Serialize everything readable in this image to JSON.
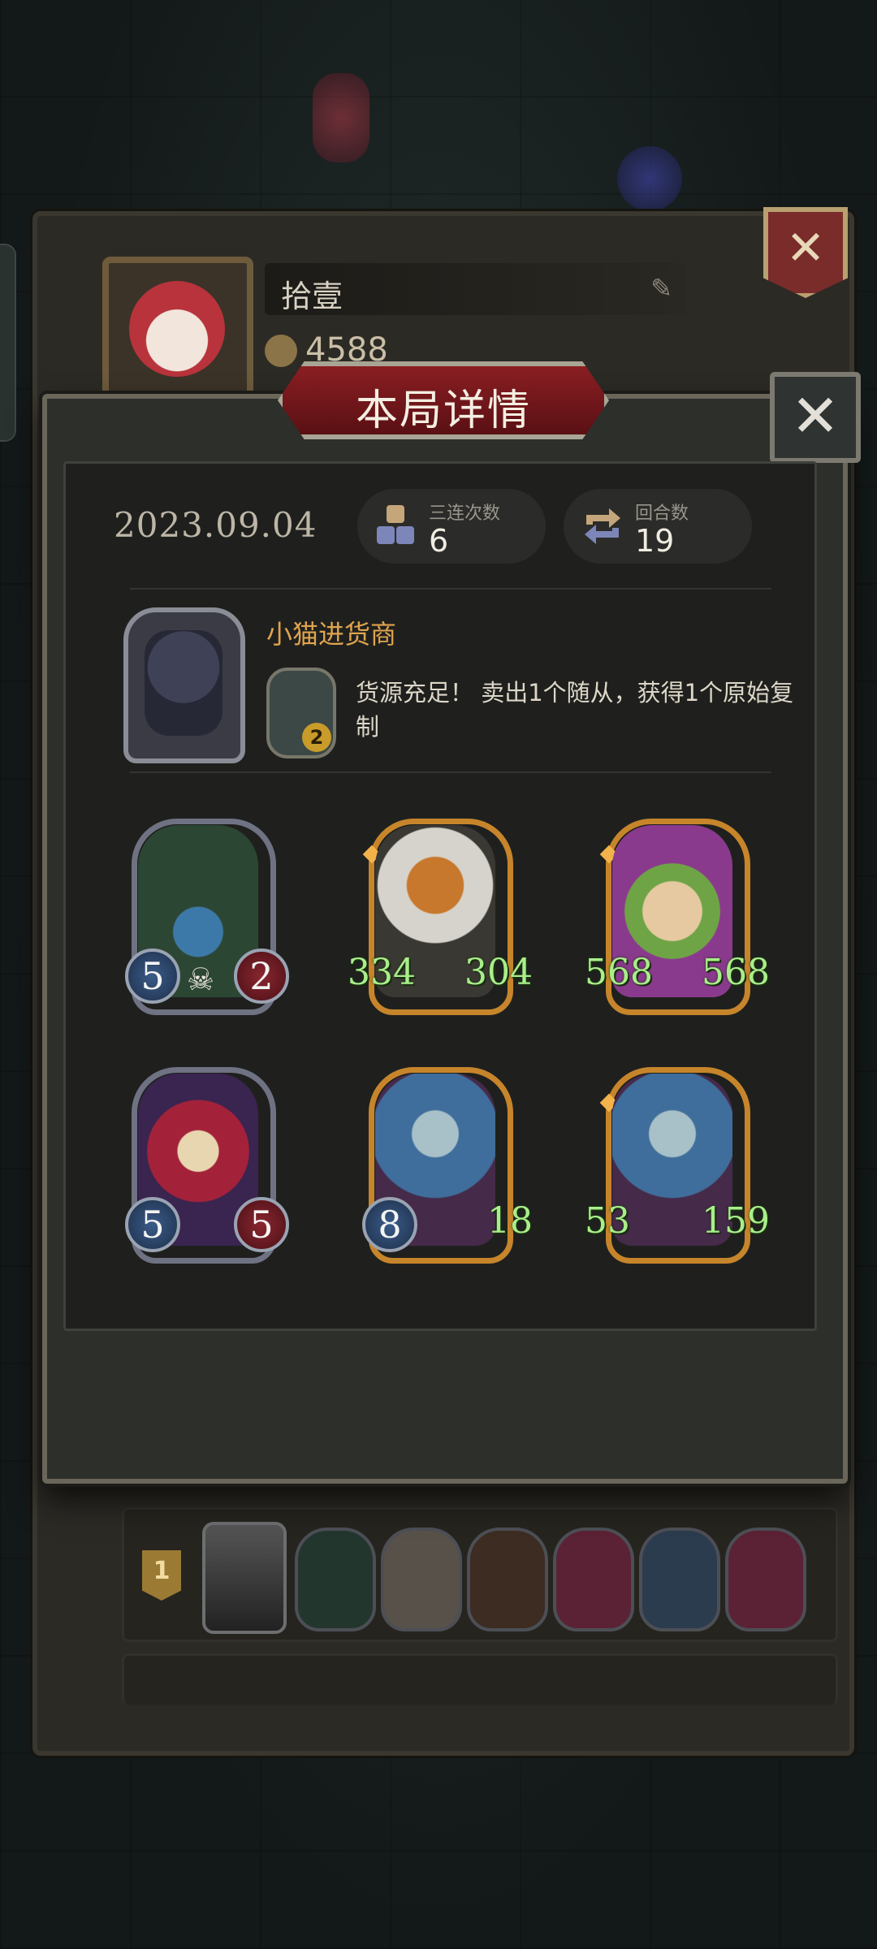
{
  "profile": {
    "player_name": "拾壹",
    "coins": "4588"
  },
  "modal": {
    "title": "本局详情",
    "close_symbol": "✕",
    "date": "2023.09.04",
    "stats": {
      "triples_label": "三连次数",
      "triples_value": "6",
      "rounds_label": "回合数",
      "rounds_value": "19"
    },
    "hero": {
      "name": "小猫进货商",
      "skill_level": "2",
      "skill_description": "货源充足！ 卖出1个随从，获得1个原始复制"
    },
    "minions": [
      {
        "attack": "5",
        "health": "2",
        "tier": "normal"
      },
      {
        "attack": "334",
        "health": "304",
        "tier": "golden"
      },
      {
        "attack": "568",
        "health": "568",
        "tier": "golden"
      },
      {
        "attack": "5",
        "health": "5",
        "tier": "normal"
      },
      {
        "attack": "8",
        "health": "18",
        "tier": "golden"
      },
      {
        "attack": "53",
        "health": "159",
        "tier": "golden"
      }
    ]
  },
  "leaderboard": {
    "rank_1": "1"
  },
  "colors": {
    "title_red": "#8a1e22",
    "hero_name": "#e0a44e",
    "buffed_stat": "#a9ee8a",
    "gold_frame": "#c7852b"
  }
}
